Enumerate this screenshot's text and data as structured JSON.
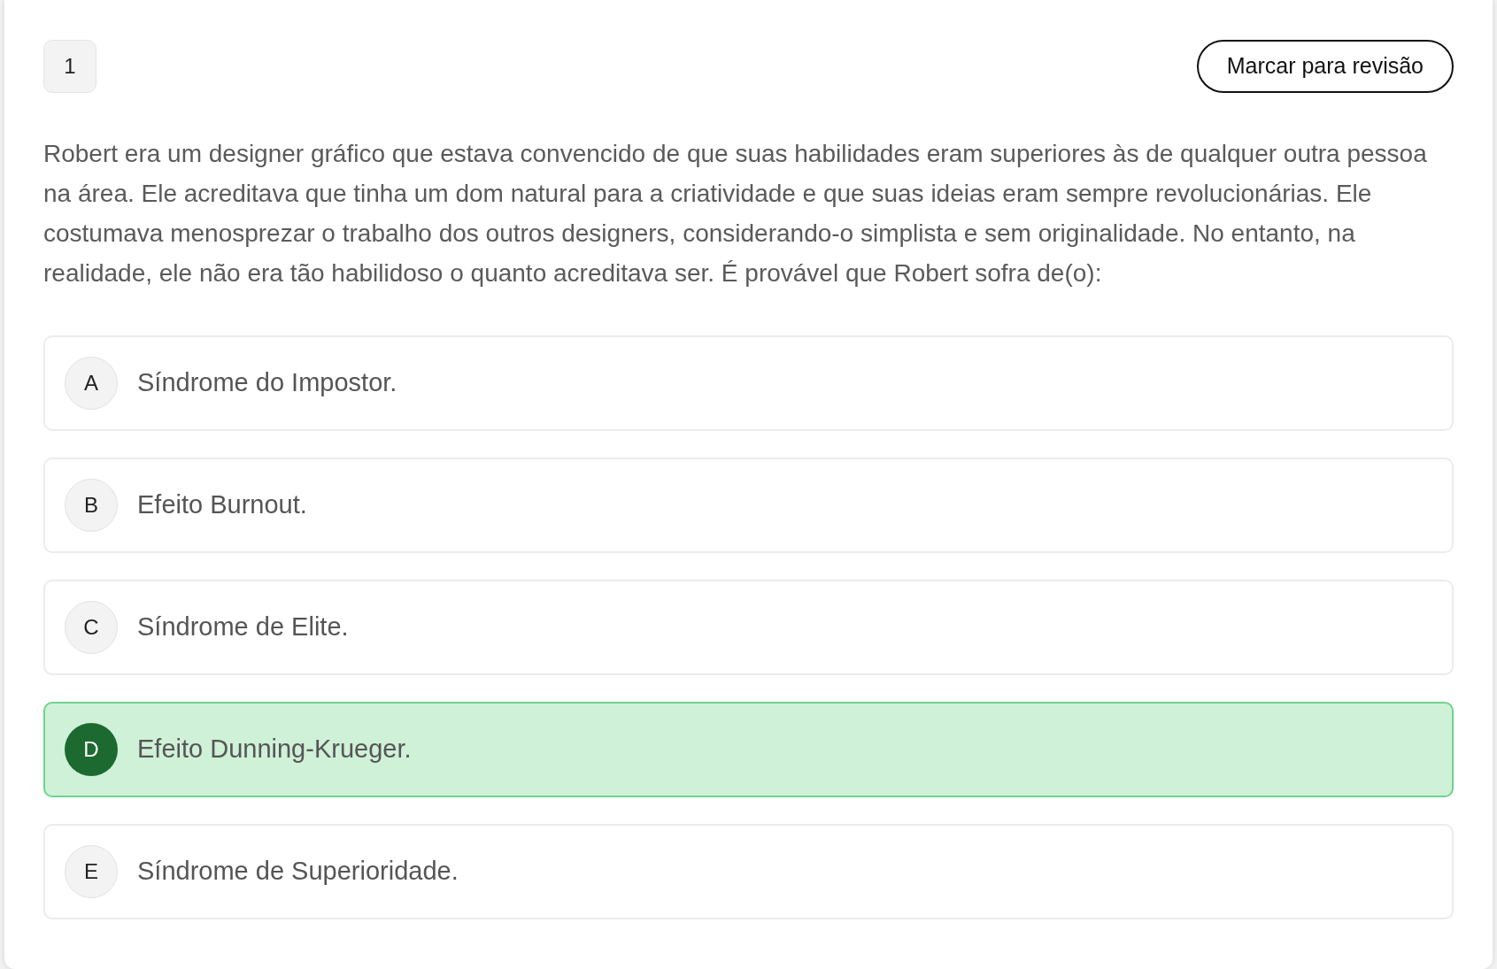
{
  "question": {
    "number": "1",
    "review_button": "Marcar para revisão",
    "text": "Robert era um designer gráfico que estava convencido de que suas habilidades eram superiores às de qualquer outra pessoa na área. Ele acreditava que tinha um dom natural para a criatividade e que suas ideias eram sempre revolucionárias. Ele costumava menosprezar o trabalho dos outros designers, considerando-o simplista e sem originalidade. No entanto, na realidade, ele não era tão habilidoso o quanto acreditava ser. É provável que Robert sofra de(o):"
  },
  "options": [
    {
      "letter": "A",
      "text": "Síndrome do Impostor.",
      "selected": false
    },
    {
      "letter": "B",
      "text": "Efeito Burnout.",
      "selected": false
    },
    {
      "letter": "C",
      "text": "Síndrome de Elite.",
      "selected": false
    },
    {
      "letter": "D",
      "text": "Efeito Dunning-Krueger.",
      "selected": true
    },
    {
      "letter": "E",
      "text": "Síndrome de Superioridade.",
      "selected": false
    }
  ]
}
